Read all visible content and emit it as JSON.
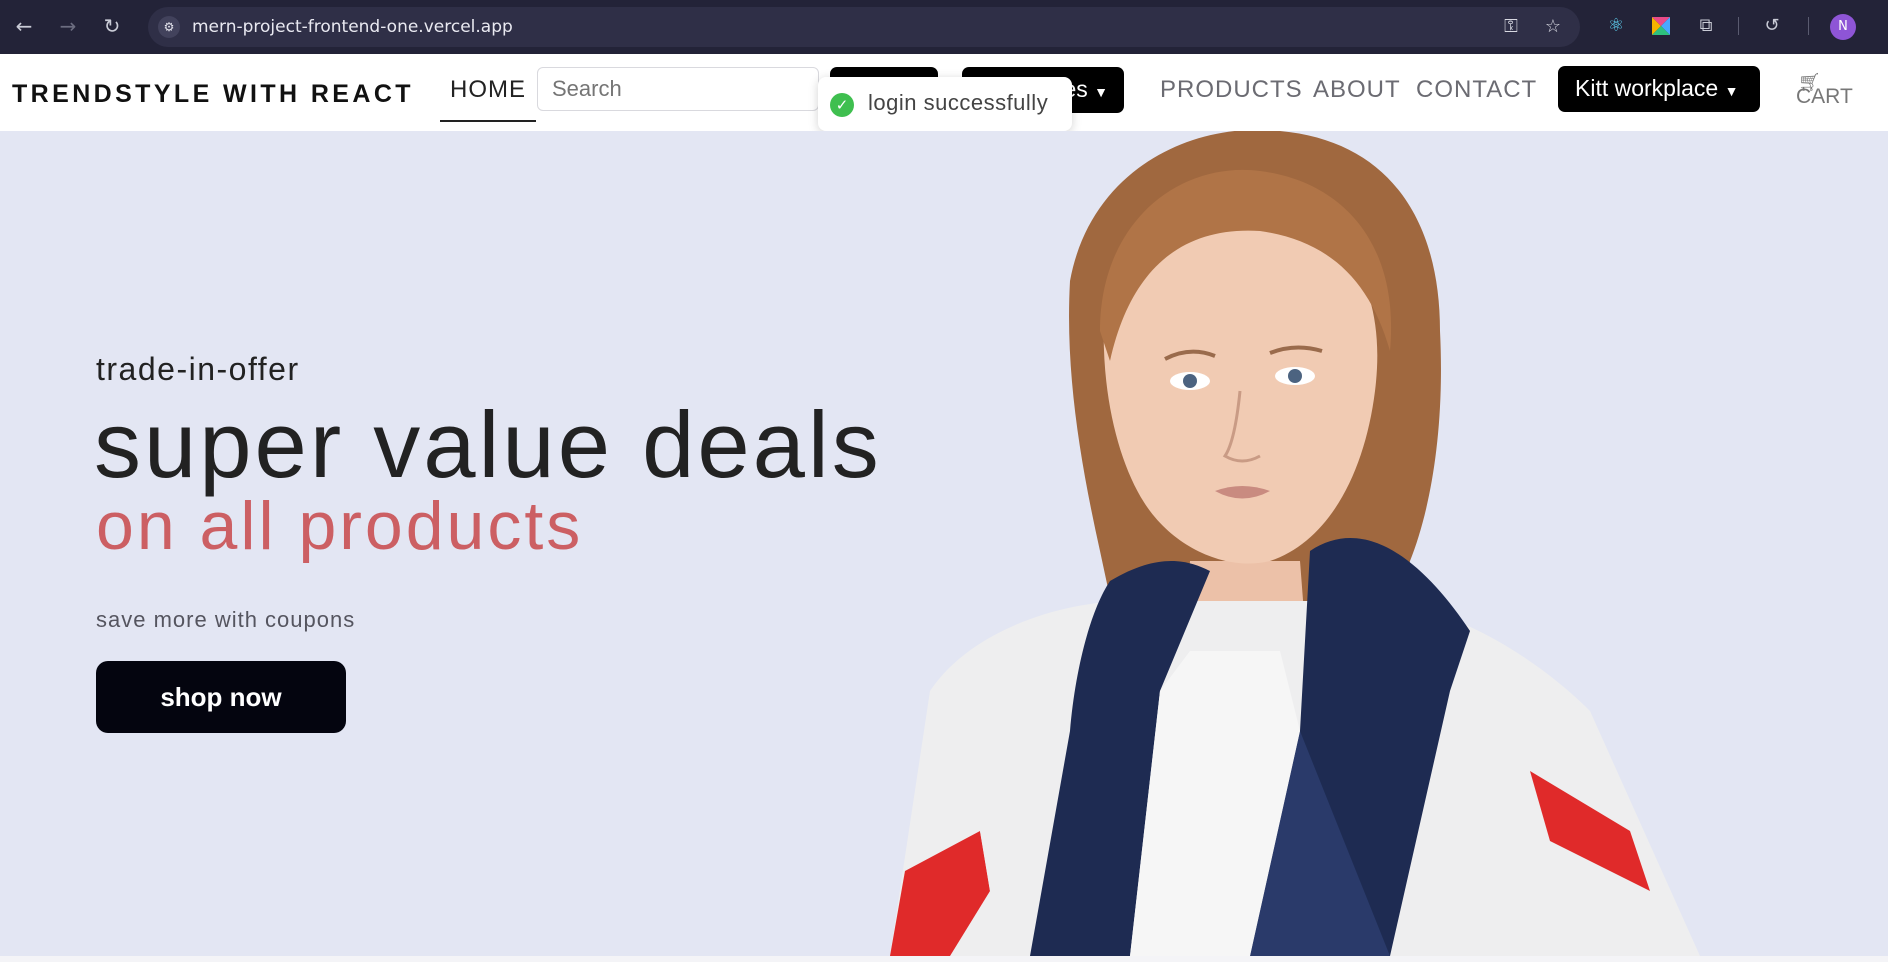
{
  "browser": {
    "url": "mern-project-frontend-one.vercel.app",
    "profile_initial": "N",
    "icons": [
      "back-arrow-icon",
      "forward-arrow-icon",
      "reload-icon",
      "site-info-icon",
      "password-key-icon",
      "bookmark-star-icon",
      "react-devtools-icon",
      "colorful-extension-icon",
      "extensions-puzzle-icon",
      "history-icon",
      "profile-avatar"
    ]
  },
  "navbar": {
    "brand": "TRENDSTYLE WITH REACT",
    "home": "HOME",
    "search_placeholder": "Search",
    "categories_btn_partial": "es",
    "products": "PRODUCTS",
    "about": "ABOUT",
    "contact": "CONTACT",
    "workplace_btn": "Kitt workplace",
    "cart": "CART"
  },
  "toast": {
    "message": "login successfully"
  },
  "hero": {
    "subtitle": "trade-in-offer",
    "title": "super value deals",
    "accent": "on all products",
    "caption": "save more with coupons",
    "cta": "shop now"
  },
  "colors": {
    "browser_bg": "#232338",
    "hero_bg": "#e3e6f3",
    "accent": "#cc5f63",
    "cta_bg": "#04050f",
    "toast_success": "#3fbf4f"
  }
}
